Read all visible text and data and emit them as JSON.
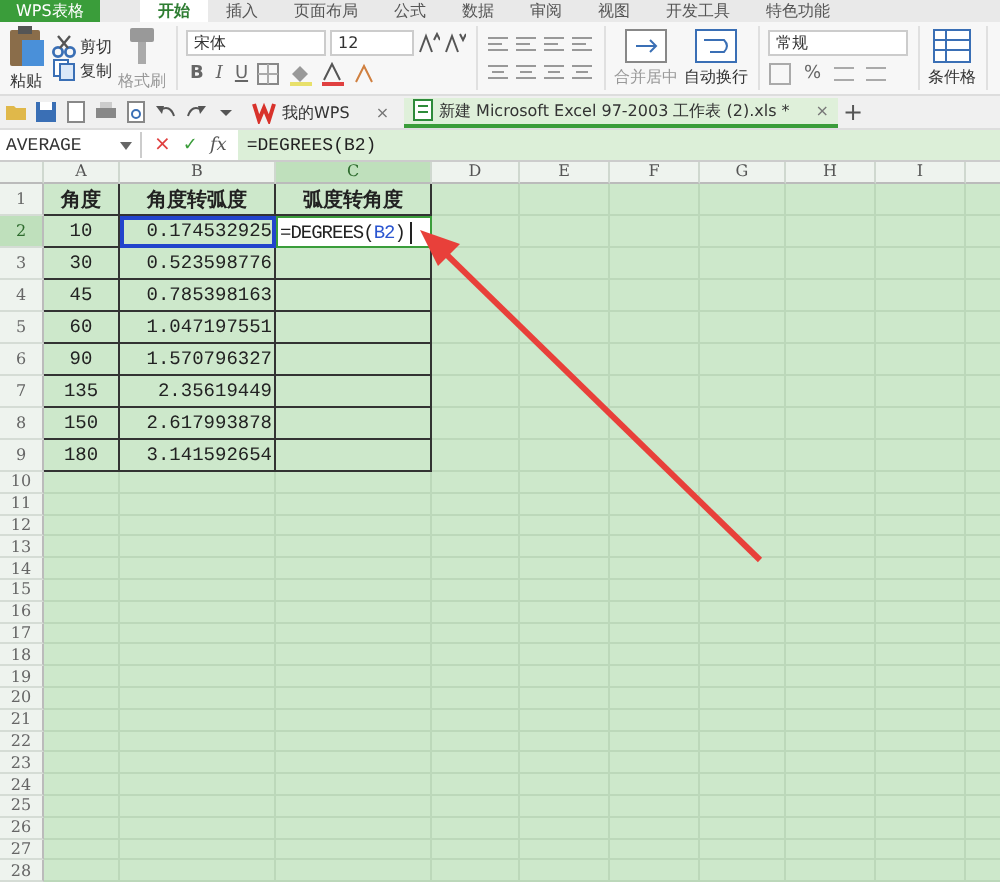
{
  "app_button": "WPS表格",
  "ribbon_tabs": [
    {
      "label": "开始",
      "kind": "tab",
      "selected": true
    },
    {
      "label": "插入",
      "kind": "tab",
      "selected": false
    },
    {
      "label": "页面布局",
      "kind": "tab",
      "selected": false
    },
    {
      "label": "公式",
      "kind": "tab",
      "selected": false
    },
    {
      "label": "数据",
      "kind": "tab",
      "selected": false
    },
    {
      "label": "审阅",
      "kind": "tab",
      "selected": false
    },
    {
      "label": "视图",
      "kind": "tab",
      "selected": false
    },
    {
      "label": "开发工具",
      "kind": "tab",
      "selected": false
    },
    {
      "label": "特色功能",
      "kind": "tab",
      "selected": false
    }
  ],
  "ribbon": {
    "paste": "粘贴",
    "cut": "剪切",
    "copy": "复制",
    "format_painter": "格式刷",
    "font": "宋体",
    "font_size": "12",
    "bold": "B",
    "italic": "I",
    "underline": "U",
    "merge": "合并居中",
    "wrap": "自动换行",
    "number_format": "常规",
    "percent": "%",
    "conditional": "条件格"
  },
  "doc_tabs": [
    {
      "label": "我的WPS",
      "selected": false,
      "close": "×"
    },
    {
      "label": "新建 Microsoft Excel 97-2003 工作表 (2).xls *",
      "selected": true,
      "close": "×"
    }
  ],
  "new_tab": "+",
  "formula_bar": {
    "name_box": "AVERAGE",
    "cancel": "×",
    "confirm": "✓",
    "fx": "fx",
    "formula": "=DEGREES(B2)"
  },
  "columns": [
    {
      "label": "A",
      "active": false
    },
    {
      "label": "B",
      "active": false
    },
    {
      "label": "C",
      "active": true
    },
    {
      "label": "D",
      "active": false
    },
    {
      "label": "E",
      "active": false
    },
    {
      "label": "F",
      "active": false
    },
    {
      "label": "G",
      "active": false
    },
    {
      "label": "H",
      "active": false
    },
    {
      "label": "I",
      "active": false
    }
  ],
  "rows": [
    {
      "label": "1",
      "active": false,
      "cells": [
        {
          "kind": "header",
          "text": "角度",
          "selected": false
        },
        {
          "kind": "header",
          "text": "角度转弧度",
          "selected": false
        },
        {
          "kind": "header",
          "text": "弧度转角度",
          "selected": false
        }
      ]
    },
    {
      "label": "2",
      "active": true,
      "cells": [
        {
          "kind": "number",
          "text": "10",
          "selected": false
        },
        {
          "kind": "number",
          "text": "0.174532925",
          "selected": true
        },
        {
          "kind": "formula",
          "before": "=DEGREES(",
          "ref": "B2",
          "after": ")",
          "selected": false
        }
      ]
    },
    {
      "label": "3",
      "active": false,
      "cells": [
        {
          "kind": "number",
          "text": "30",
          "selected": false
        },
        {
          "kind": "number",
          "text": "0.523598776",
          "selected": false
        }
      ]
    },
    {
      "label": "4",
      "active": false,
      "cells": [
        {
          "kind": "number",
          "text": "45",
          "selected": false
        },
        {
          "kind": "number",
          "text": "0.785398163",
          "selected": false
        }
      ]
    },
    {
      "label": "5",
      "active": false,
      "cells": [
        {
          "kind": "number",
          "text": "60",
          "selected": false
        },
        {
          "kind": "number",
          "text": "1.047197551",
          "selected": false
        }
      ]
    },
    {
      "label": "6",
      "active": false,
      "cells": [
        {
          "kind": "number",
          "text": "90",
          "selected": false
        },
        {
          "kind": "number",
          "text": "1.570796327",
          "selected": false
        }
      ]
    },
    {
      "label": "7",
      "active": false,
      "cells": [
        {
          "kind": "number",
          "text": "135",
          "selected": false
        },
        {
          "kind": "number",
          "text": "2.35619449",
          "selected": false
        }
      ]
    },
    {
      "label": "8",
      "active": false,
      "cells": [
        {
          "kind": "number",
          "text": "150",
          "selected": false
        },
        {
          "kind": "number",
          "text": "2.617993878",
          "selected": false
        }
      ]
    },
    {
      "label": "9",
      "active": false,
      "cells": [
        {
          "kind": "number",
          "text": "180",
          "selected": false
        },
        {
          "kind": "number",
          "text": "3.141592654",
          "selected": false
        }
      ]
    },
    {
      "label": "10",
      "active": false
    },
    {
      "label": "11",
      "active": false
    },
    {
      "label": "12",
      "active": false
    },
    {
      "label": "13",
      "active": false
    },
    {
      "label": "14",
      "active": false
    },
    {
      "label": "15",
      "active": false
    },
    {
      "label": "16",
      "active": false
    },
    {
      "label": "17",
      "active": false
    },
    {
      "label": "18",
      "active": false
    },
    {
      "label": "19",
      "active": false
    },
    {
      "label": "20",
      "active": false
    },
    {
      "label": "21",
      "active": false
    },
    {
      "label": "22",
      "active": false
    },
    {
      "label": "23",
      "active": false
    },
    {
      "label": "24",
      "active": false
    },
    {
      "label": "25",
      "active": false
    },
    {
      "label": "26",
      "active": false
    },
    {
      "label": "27",
      "active": false
    },
    {
      "label": "28",
      "active": false
    }
  ]
}
